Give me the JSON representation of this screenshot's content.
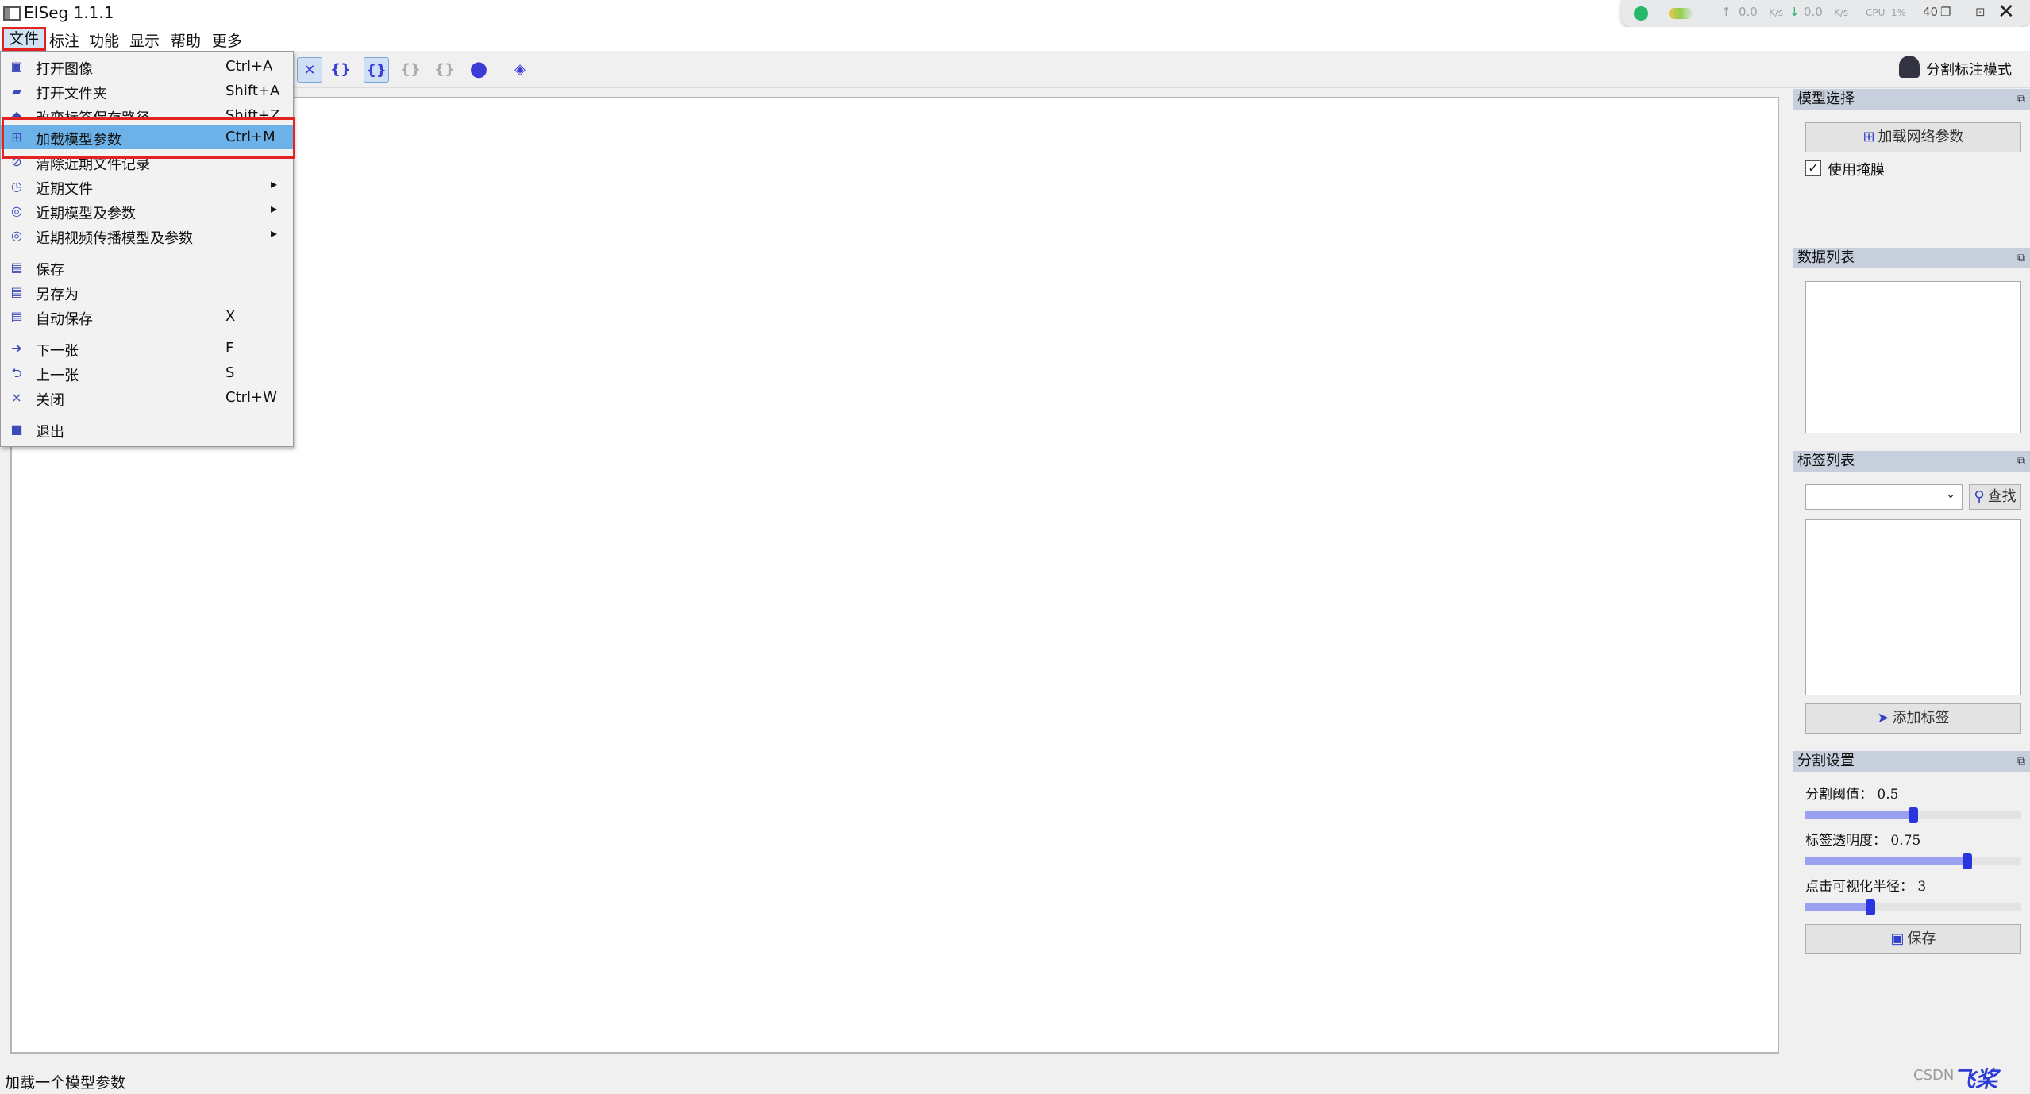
{
  "window": {
    "title": "EISeg 1.1.1"
  },
  "tray": {
    "up_speed": "0.0",
    "down_speed": "0.0",
    "unit": "K/s",
    "cpu_label": "CPU",
    "cpu_value": "1%",
    "temp": "40",
    "close_glyph": "✕"
  },
  "menubar": {
    "items": [
      "文件",
      "标注",
      "功能",
      "显示",
      "帮助",
      "更多"
    ]
  },
  "toolbar": {
    "mode_label": "分割标注模式"
  },
  "file_menu": {
    "items": [
      {
        "label": "打开图像",
        "shortcut": "Ctrl+A",
        "icon": "image-icon"
      },
      {
        "label": "打开文件夹",
        "shortcut": "Shift+A",
        "icon": "folder-icon"
      },
      {
        "label": "改变标签保存路径",
        "shortcut": "Shift+Z",
        "icon": "path-icon"
      },
      {
        "label": "加载模型参数",
        "shortcut": "Ctrl+M",
        "icon": "model-icon"
      },
      {
        "label": "清除近期文件记录",
        "shortcut": "",
        "icon": "clear-icon"
      },
      {
        "label": "近期文件",
        "shortcut": "",
        "icon": "recent-icon",
        "submenu": true
      },
      {
        "label": "近期模型及参数",
        "shortcut": "",
        "icon": "recent-model-icon",
        "submenu": true
      },
      {
        "label": "近期视频传播模型及参数",
        "shortcut": "",
        "icon": "recent-video-icon",
        "submenu": true
      },
      {
        "label": "保存",
        "shortcut": "",
        "icon": "save-icon"
      },
      {
        "label": "另存为",
        "shortcut": "",
        "icon": "save-as-icon"
      },
      {
        "label": "自动保存",
        "shortcut": "X",
        "icon": "autosave-icon"
      },
      {
        "label": "下一张",
        "shortcut": "F",
        "icon": "next-icon"
      },
      {
        "label": "上一张",
        "shortcut": "S",
        "icon": "prev-icon"
      },
      {
        "label": "关闭",
        "shortcut": "Ctrl+W",
        "icon": "close-icon"
      },
      {
        "label": "退出",
        "shortcut": "",
        "icon": "exit-icon"
      }
    ],
    "submenu_arrow": "▸"
  },
  "panels": {
    "model": {
      "title": "模型选择",
      "load_button": "加载网络参数",
      "use_mask": "使用掩膜",
      "use_mask_checked": true
    },
    "data": {
      "title": "数据列表"
    },
    "labels": {
      "title": "标签列表",
      "search_button": "查找",
      "add_button": "添加标签"
    },
    "seg": {
      "title": "分割设置",
      "threshold_label": "分割阈值：",
      "threshold_value": "0.5",
      "threshold_fraction": 0.5,
      "opacity_label": "标签透明度：",
      "opacity_value": "0.75",
      "opacity_fraction": 0.75,
      "radius_label": "点击可视化半径：",
      "radius_value": "3",
      "radius_fraction": 0.3,
      "save_button": "保存"
    }
  },
  "status": {
    "text": "加载一个模型参数"
  },
  "watermark": {
    "text": "CSDN",
    "brand": "飞桨"
  },
  "colors": {
    "accent": "#2a35e0",
    "highlight": "#e52222",
    "menu_active": "#6cb2e8",
    "panel_head": "#c7cedc"
  }
}
